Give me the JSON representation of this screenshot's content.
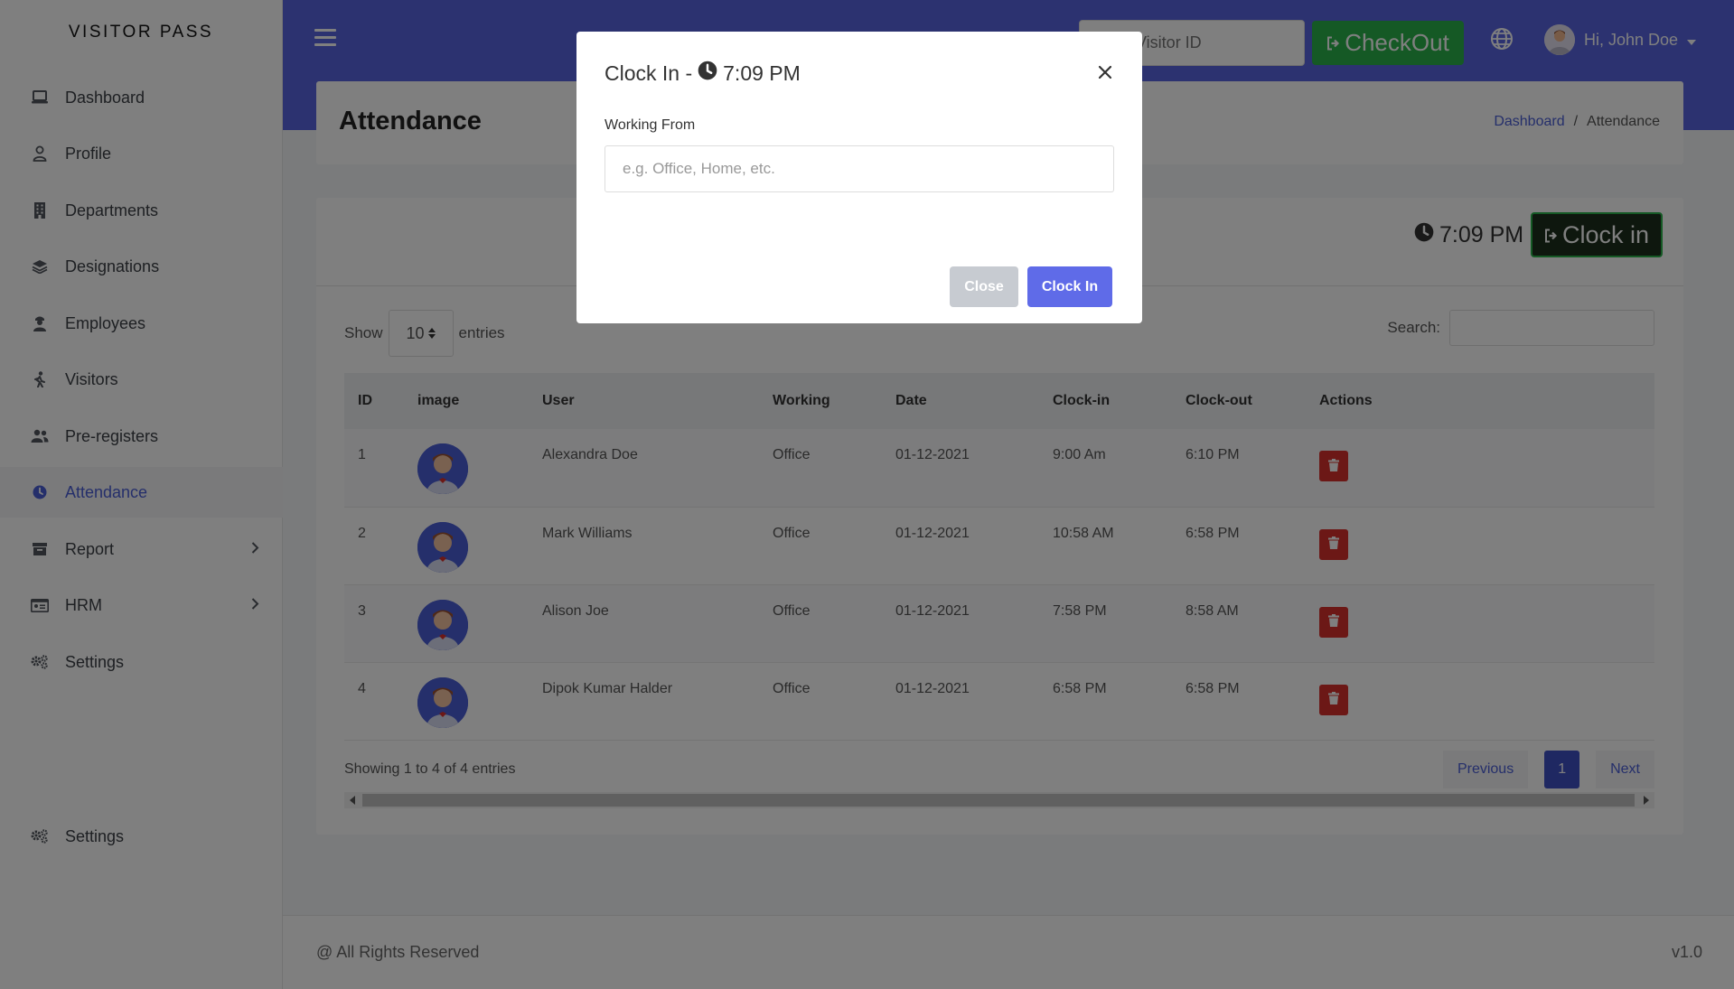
{
  "brand": "VISITOR PASS",
  "sidebar": {
    "items": [
      {
        "label": "Dashboard",
        "icon": "laptop-icon"
      },
      {
        "label": "Profile",
        "icon": "user-icon"
      },
      {
        "label": "Departments",
        "icon": "building-icon"
      },
      {
        "label": "Designations",
        "icon": "layers-icon"
      },
      {
        "label": "Employees",
        "icon": "employee-icon"
      },
      {
        "label": "Visitors",
        "icon": "walking-icon"
      },
      {
        "label": "Pre-registers",
        "icon": "users-icon"
      },
      {
        "label": "Attendance",
        "icon": "clock-icon",
        "active": true
      },
      {
        "label": "Report",
        "icon": "archive-icon",
        "has_submenu": true
      },
      {
        "label": "HRM",
        "icon": "id-card-icon",
        "has_submenu": true
      },
      {
        "label": "Settings",
        "icon": "cogs-icon"
      }
    ],
    "bottom_settings": "Settings"
  },
  "header": {
    "visitor_id_placeholder": "Visitor ID",
    "checkout_label": "CheckOut",
    "user_greeting": "Hi, John Doe"
  },
  "page": {
    "title": "Attendance",
    "breadcrumb": [
      "Dashboard",
      "Attendance"
    ],
    "breadcrumb_sep": "/"
  },
  "card": {
    "clock_time": "7:09 PM",
    "clock_in_label": "Clock in",
    "show_label": "Show",
    "entries_value": "10",
    "entries_label": "entries",
    "search_label": "Search:"
  },
  "table": {
    "columns": [
      "ID",
      "image",
      "User",
      "Working",
      "Date",
      "Clock-in",
      "Clock-out",
      "Actions"
    ],
    "rows": [
      {
        "id": "1",
        "user": "Alexandra Doe",
        "working": "Office",
        "date": "01-12-2021",
        "clock_in": "9:00 Am",
        "clock_out": "6:10 PM"
      },
      {
        "id": "2",
        "user": "Mark Williams",
        "working": "Office",
        "date": "01-12-2021",
        "clock_in": "10:58 AM",
        "clock_out": "6:58 PM"
      },
      {
        "id": "3",
        "user": "Alison Joe",
        "working": "Office",
        "date": "01-12-2021",
        "clock_in": "7:58 PM",
        "clock_out": "8:58 AM"
      },
      {
        "id": "4",
        "user": "Dipok Kumar Halder",
        "working": "Office",
        "date": "01-12-2021",
        "clock_in": "6:58 PM",
        "clock_out": "6:58 PM"
      }
    ],
    "info": "Showing 1 to 4 of 4 entries",
    "pager": {
      "previous": "Previous",
      "current": "1",
      "next": "Next"
    }
  },
  "footer": {
    "copyright": "@ All Rights Reserved",
    "version": "v1.0"
  },
  "modal": {
    "title_prefix": "Clock In -",
    "time": "7:09 PM",
    "field_label": "Working From",
    "field_placeholder": "e.g. Office, Home, etc.",
    "close_label": "Close",
    "submit_label": "Clock In"
  },
  "colors": {
    "accent": "#5865e0",
    "active_nav": "#4b5fd6",
    "checkout": "#2bb34a",
    "danger": "#d9302c"
  }
}
